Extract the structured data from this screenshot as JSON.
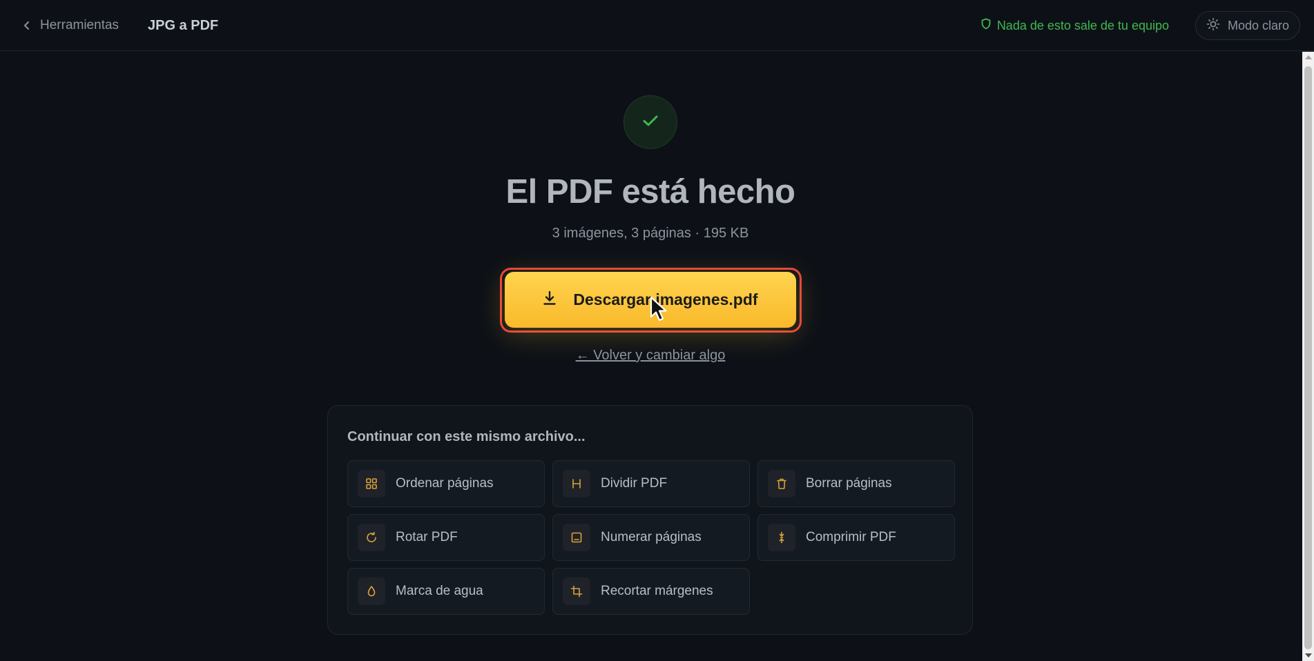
{
  "header": {
    "back_label": "Herramientas",
    "title": "JPG a PDF",
    "privacy_text": "Nada de esto sale de tu equipo",
    "theme_toggle_label": "Modo claro"
  },
  "hero": {
    "status_icon": "check-icon",
    "title": "El PDF está hecho",
    "summary": "3 imágenes, 3 páginas · 195 KB",
    "download_label": "Descargar imagenes.pdf",
    "back_change_label": "← Volver y cambiar algo"
  },
  "continue": {
    "title": "Continuar con este mismo archivo...",
    "tools": [
      {
        "label": "Ordenar páginas",
        "icon": "grid-icon"
      },
      {
        "label": "Dividir PDF",
        "icon": "split-icon"
      },
      {
        "label": "Borrar páginas",
        "icon": "trash-icon"
      },
      {
        "label": "Rotar PDF",
        "icon": "rotate-icon"
      },
      {
        "label": "Numerar páginas",
        "icon": "page-number-icon"
      },
      {
        "label": "Comprimir PDF",
        "icon": "compress-icon"
      },
      {
        "label": "Marca de agua",
        "icon": "droplet-icon"
      },
      {
        "label": "Recortar márgenes",
        "icon": "crop-icon"
      }
    ]
  },
  "colors": {
    "accent": "#fbbf2d",
    "success": "#3fb950",
    "background": "#0d1117",
    "highlight": "#e5433a"
  }
}
